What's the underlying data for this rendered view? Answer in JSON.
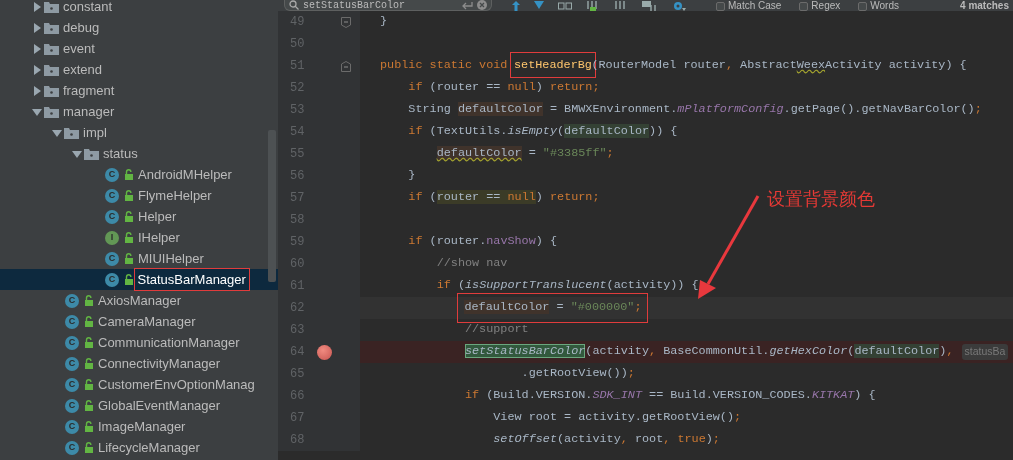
{
  "project_tree": [
    {
      "label": "constant",
      "kind": "package",
      "expanded": false,
      "selected": false
    },
    {
      "label": "debug",
      "kind": "package",
      "expanded": false,
      "selected": false
    },
    {
      "label": "event",
      "kind": "package",
      "expanded": false,
      "selected": false
    },
    {
      "label": "extend",
      "kind": "package",
      "expanded": false,
      "selected": false
    },
    {
      "label": "fragment",
      "kind": "package",
      "expanded": false,
      "selected": false
    },
    {
      "label": "manager",
      "kind": "package",
      "expanded": true,
      "selected": false,
      "children": [
        {
          "label": "impl",
          "kind": "package",
          "expanded": true,
          "selected": false,
          "children": [
            {
              "label": "status",
              "kind": "package",
              "expanded": true,
              "selected": false,
              "children": [
                {
                  "label": "AndroidMHelper",
                  "kind": "class",
                  "badge": "C",
                  "selected": false
                },
                {
                  "label": "FlymeHelper",
                  "kind": "class",
                  "badge": "C",
                  "selected": false
                },
                {
                  "label": "Helper",
                  "kind": "class",
                  "badge": "C",
                  "selected": false
                },
                {
                  "label": "IHelper",
                  "kind": "interface",
                  "badge": "I",
                  "selected": false
                },
                {
                  "label": "MIUIHelper",
                  "kind": "class",
                  "badge": "C",
                  "selected": false
                },
                {
                  "label": "StatusBarManager",
                  "kind": "class",
                  "badge": "C",
                  "selected": true,
                  "annotated": true
                }
              ]
            }
          ]
        },
        {
          "label": "AxiosManager",
          "kind": "class",
          "badge": "C",
          "selected": false
        },
        {
          "label": "CameraManager",
          "kind": "class",
          "badge": "C",
          "selected": false
        },
        {
          "label": "CommunicationManager",
          "kind": "class",
          "badge": "C",
          "selected": false
        },
        {
          "label": "ConnectivityManager",
          "kind": "class",
          "badge": "C",
          "selected": false
        },
        {
          "label": "CustomerEnvOptionManag",
          "kind": "class",
          "badge": "C",
          "selected": false
        },
        {
          "label": "GlobalEventManager",
          "kind": "class",
          "badge": "C",
          "selected": false
        },
        {
          "label": "ImageManager",
          "kind": "class",
          "badge": "C",
          "selected": false
        },
        {
          "label": "LifecycleManager",
          "kind": "class",
          "badge": "C",
          "selected": false
        }
      ]
    }
  ],
  "find_bar": {
    "query": "setStatusBarColor",
    "options": [
      {
        "label": "Match Case",
        "checked": false
      },
      {
        "label": "Regex",
        "checked": false
      },
      {
        "label": "Words",
        "checked": false
      }
    ],
    "match_count": "4 matches"
  },
  "editor": {
    "lines": [
      {
        "number": "49",
        "fold_end": true,
        "segments": [
          {
            "text": "}",
            "kind": "plain"
          }
        ]
      },
      {
        "number": "50"
      },
      {
        "number": "51",
        "fold_start": true,
        "segments": [
          {
            "text": "public static void ",
            "kind": "keyword"
          },
          {
            "text": "setHeaderBg",
            "kind": "declaration",
            "annotated": true
          },
          {
            "text": "(RouterModel router",
            "kind": "plain"
          },
          {
            "text": ", ",
            "kind": "keyword"
          },
          {
            "text": "Abstract",
            "kind": "plain"
          },
          {
            "text": "Weex",
            "kind": "plain",
            "warning": true
          },
          {
            "text": "Activity activity) {",
            "kind": "plain"
          }
        ]
      },
      {
        "number": "52",
        "segments": [
          {
            "text": "    if",
            "kind": "keyword"
          },
          {
            "text": " (router == ",
            "kind": "plain"
          },
          {
            "text": "null",
            "kind": "keyword"
          },
          {
            "text": ") ",
            "kind": "plain"
          },
          {
            "text": "return;",
            "kind": "keyword"
          }
        ]
      },
      {
        "number": "53",
        "segments": [
          {
            "text": "    String ",
            "kind": "plain"
          },
          {
            "text": "defaultColor",
            "kind": "plain",
            "write_usage": true
          },
          {
            "text": " = BMWXEnvironment.",
            "kind": "plain"
          },
          {
            "text": "mPlatformConfig",
            "kind": "static-field"
          },
          {
            "text": ".getPage().getNavBarColor()",
            "kind": "plain"
          },
          {
            "text": ";",
            "kind": "keyword"
          }
        ]
      },
      {
        "number": "54",
        "segments": [
          {
            "text": "    if",
            "kind": "keyword"
          },
          {
            "text": " (TextUtils.",
            "kind": "plain"
          },
          {
            "text": "isEmpty",
            "kind": "static-call"
          },
          {
            "text": "(",
            "kind": "plain"
          },
          {
            "text": "defaultColor",
            "kind": "plain",
            "read_usage": true
          },
          {
            "text": ")) {",
            "kind": "plain"
          }
        ]
      },
      {
        "number": "55",
        "segments": [
          {
            "text": "        defaultColor",
            "kind": "plain",
            "write_usage": true,
            "warning": true
          },
          {
            "text": " = ",
            "kind": "plain"
          },
          {
            "text": "\"#3385ff\"",
            "kind": "string"
          },
          {
            "text": ";",
            "kind": "keyword"
          }
        ]
      },
      {
        "number": "56",
        "segments": [
          {
            "text": "    }",
            "kind": "plain"
          }
        ]
      },
      {
        "number": "57",
        "segments": [
          {
            "text": "    if",
            "kind": "keyword"
          },
          {
            "text": " (",
            "kind": "plain"
          },
          {
            "text": "router == ",
            "kind": "plain",
            "usage": true
          },
          {
            "text": "null",
            "kind": "keyword",
            "usage": true
          },
          {
            "text": ") ",
            "kind": "plain"
          },
          {
            "text": "return;",
            "kind": "keyword"
          }
        ]
      },
      {
        "number": "58"
      },
      {
        "number": "59",
        "segments": [
          {
            "text": "    if",
            "kind": "keyword"
          },
          {
            "text": " (router.",
            "kind": "plain"
          },
          {
            "text": "navShow",
            "kind": "field"
          },
          {
            "text": ") {",
            "kind": "plain"
          }
        ]
      },
      {
        "number": "60",
        "segments": [
          {
            "text": "        //show nav",
            "kind": "comment"
          }
        ]
      },
      {
        "number": "61",
        "segments": [
          {
            "text": "        if",
            "kind": "keyword"
          },
          {
            "text": " (",
            "kind": "plain"
          },
          {
            "text": "isSupportTranslucent",
            "kind": "static-call"
          },
          {
            "text": "(activity)) {",
            "kind": "plain"
          }
        ]
      },
      {
        "number": "62",
        "current": true,
        "annotated": true,
        "segments": [
          {
            "text": "            defaultColor",
            "kind": "plain",
            "write_usage": true
          },
          {
            "text": " = ",
            "kind": "plain"
          },
          {
            "text": "\"#000000\"",
            "kind": "string"
          },
          {
            "text": ";",
            "kind": "keyword"
          }
        ]
      },
      {
        "number": "63",
        "segments": [
          {
            "text": "            //support",
            "kind": "comment"
          }
        ]
      },
      {
        "number": "64",
        "breakpoint": true,
        "hint": "statusBa",
        "segments": [
          {
            "text": "            setStatusBarColor",
            "kind": "static-call",
            "search_match": true
          },
          {
            "text": "(activity",
            "kind": "plain"
          },
          {
            "text": ", ",
            "kind": "keyword"
          },
          {
            "text": "BaseCommonUtil.",
            "kind": "plain"
          },
          {
            "text": "getHexColor",
            "kind": "static-call"
          },
          {
            "text": "(",
            "kind": "plain"
          },
          {
            "text": "defaultColor",
            "kind": "plain",
            "read_usage": true
          },
          {
            "text": ")",
            "kind": "plain"
          },
          {
            "text": ",",
            "kind": "keyword"
          }
        ]
      },
      {
        "number": "65",
        "segments": [
          {
            "text": "                    .getRootView())",
            "kind": "plain"
          },
          {
            "text": ";",
            "kind": "keyword"
          }
        ]
      },
      {
        "number": "66",
        "segments": [
          {
            "text": "            if",
            "kind": "keyword"
          },
          {
            "text": " (Build.VERSION.",
            "kind": "plain"
          },
          {
            "text": "SDK_INT",
            "kind": "static-field"
          },
          {
            "text": " == Build.VERSION_CODES.",
            "kind": "plain"
          },
          {
            "text": "KITKAT",
            "kind": "static-field"
          },
          {
            "text": ") {",
            "kind": "plain"
          }
        ]
      },
      {
        "number": "67",
        "segments": [
          {
            "text": "                View root = activity.getRootView()",
            "kind": "plain"
          },
          {
            "text": ";",
            "kind": "keyword"
          }
        ]
      },
      {
        "number": "68",
        "segments": [
          {
            "text": "                setOffset",
            "kind": "static-call"
          },
          {
            "text": "(activity",
            "kind": "plain"
          },
          {
            "text": ", ",
            "kind": "keyword"
          },
          {
            "text": "root",
            "kind": "plain"
          },
          {
            "text": ", ",
            "kind": "keyword"
          },
          {
            "text": "true",
            "kind": "keyword"
          },
          {
            "text": ")",
            "kind": "plain"
          },
          {
            "text": ";",
            "kind": "keyword"
          }
        ]
      }
    ]
  },
  "annotation": {
    "text": "设置背景颜色"
  }
}
